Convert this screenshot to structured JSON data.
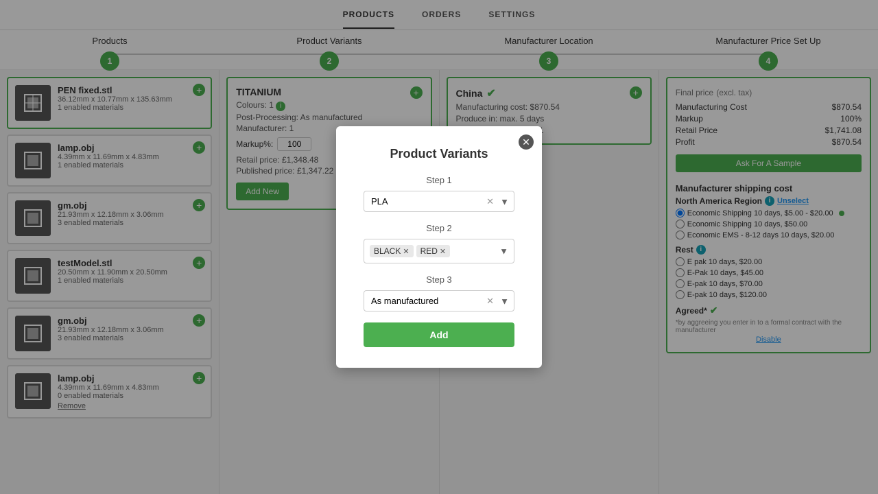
{
  "topNav": {
    "items": [
      {
        "label": "PRODUCTS",
        "active": true
      },
      {
        "label": "ORDERS",
        "active": false
      },
      {
        "label": "SETTINGS",
        "active": false
      }
    ]
  },
  "progressSteps": [
    {
      "label": "Products",
      "number": "1",
      "active": true
    },
    {
      "label": "Product Variants",
      "number": "2",
      "active": true
    },
    {
      "label": "Manufacturer Location",
      "number": "3",
      "active": true
    },
    {
      "label": "Manufacturer Price Set Up",
      "number": "4",
      "active": true
    }
  ],
  "col1": {
    "cards": [
      {
        "title": "PEN fixed.stl",
        "dim": "36.12mm x 10.77mm x 135.63mm",
        "enabled": "1 enabled materials",
        "selected": true
      },
      {
        "title": "lamp.obj",
        "dim": "4.39mm x 11.69mm x 4.83mm",
        "enabled": "1 enabled materials",
        "selected": false
      },
      {
        "title": "gm.obj",
        "dim": "21.93mm x 12.18mm x 3.06mm",
        "enabled": "3 enabled materials",
        "selected": false
      },
      {
        "title": "testModel.stl",
        "dim": "20.50mm x 11.90mm x 20.50mm",
        "enabled": "1 enabled materials",
        "selected": false
      },
      {
        "title": "gm.obj",
        "dim": "21.93mm x 12.18mm x 3.06mm",
        "enabled": "3 enabled materials",
        "selected": false
      },
      {
        "title": "lamp.obj",
        "dim": "4.39mm x 11.69mm x 4.83mm",
        "enabled": "0 enabled materials",
        "selected": false,
        "hasRemove": true
      }
    ]
  },
  "col2": {
    "title": "TITANIUM",
    "coloursLabel": "Colours: 1",
    "postProcessing": "Post-Processing: As manufactured",
    "manufacturer": "Manufacturer: 1",
    "markupLabel": "Markup%:",
    "markupValue": "100",
    "retailPrice": "Retail price: £1,348.48",
    "publishedPrice": "Published price: £1,347.22 S...",
    "addNewLabel": "Add New"
  },
  "col3": {
    "title": "China",
    "manufacturingCost": "Manufacturing cost: $870.54",
    "produceIn": "Produce in: max. 5 days",
    "shippingZones": "Shipping zones setup: 1"
  },
  "col4": {
    "title": "Final price",
    "titleSuffix": "(excl. tax)",
    "rows": [
      {
        "label": "Manufacturing Cost",
        "value": "$870.54"
      },
      {
        "label": "Markup",
        "value": "100%"
      },
      {
        "label": "Retail Price",
        "value": "$1,741.08"
      },
      {
        "label": "Profit",
        "value": "$870.54"
      }
    ],
    "askForSampleBtn": "Ask For A Sample",
    "shippingTitle": "Manufacturer shipping cost",
    "northAmerica": {
      "title": "North America Region",
      "unselectLabel": "Unselect",
      "options": [
        {
          "label": "Economic Shipping 10 days, $5.00 - $20.00",
          "checked": true,
          "greenDot": true
        },
        {
          "label": "Economic Shipping 10 days, $50.00",
          "checked": false
        },
        {
          "label": "Economic EMS - 8-12 days 10 days, $20.00",
          "checked": false
        }
      ]
    },
    "rest": {
      "title": "Rest",
      "options": [
        {
          "label": "E pak 10 days, $20.00",
          "checked": false
        },
        {
          "label": "E-Pak 10 days, $45.00",
          "checked": false
        },
        {
          "label": "E-pak 10 days, $70.00",
          "checked": false
        },
        {
          "label": "E-pak 10 days, $120.00",
          "checked": false
        }
      ]
    },
    "agreedLabel": "Agreed*",
    "disclaimer": "*by aggreeing you enter in to a formal contract with the manufacturer",
    "disableLabel": "Disable"
  },
  "modal": {
    "title": "Product Variants",
    "step1Label": "Step 1",
    "step1Value": "PLA",
    "step2Label": "Step 2",
    "step2Tags": [
      "BLACK",
      "RED"
    ],
    "step3Label": "Step 3",
    "step3Value": "As manufactured",
    "addBtn": "Add"
  }
}
